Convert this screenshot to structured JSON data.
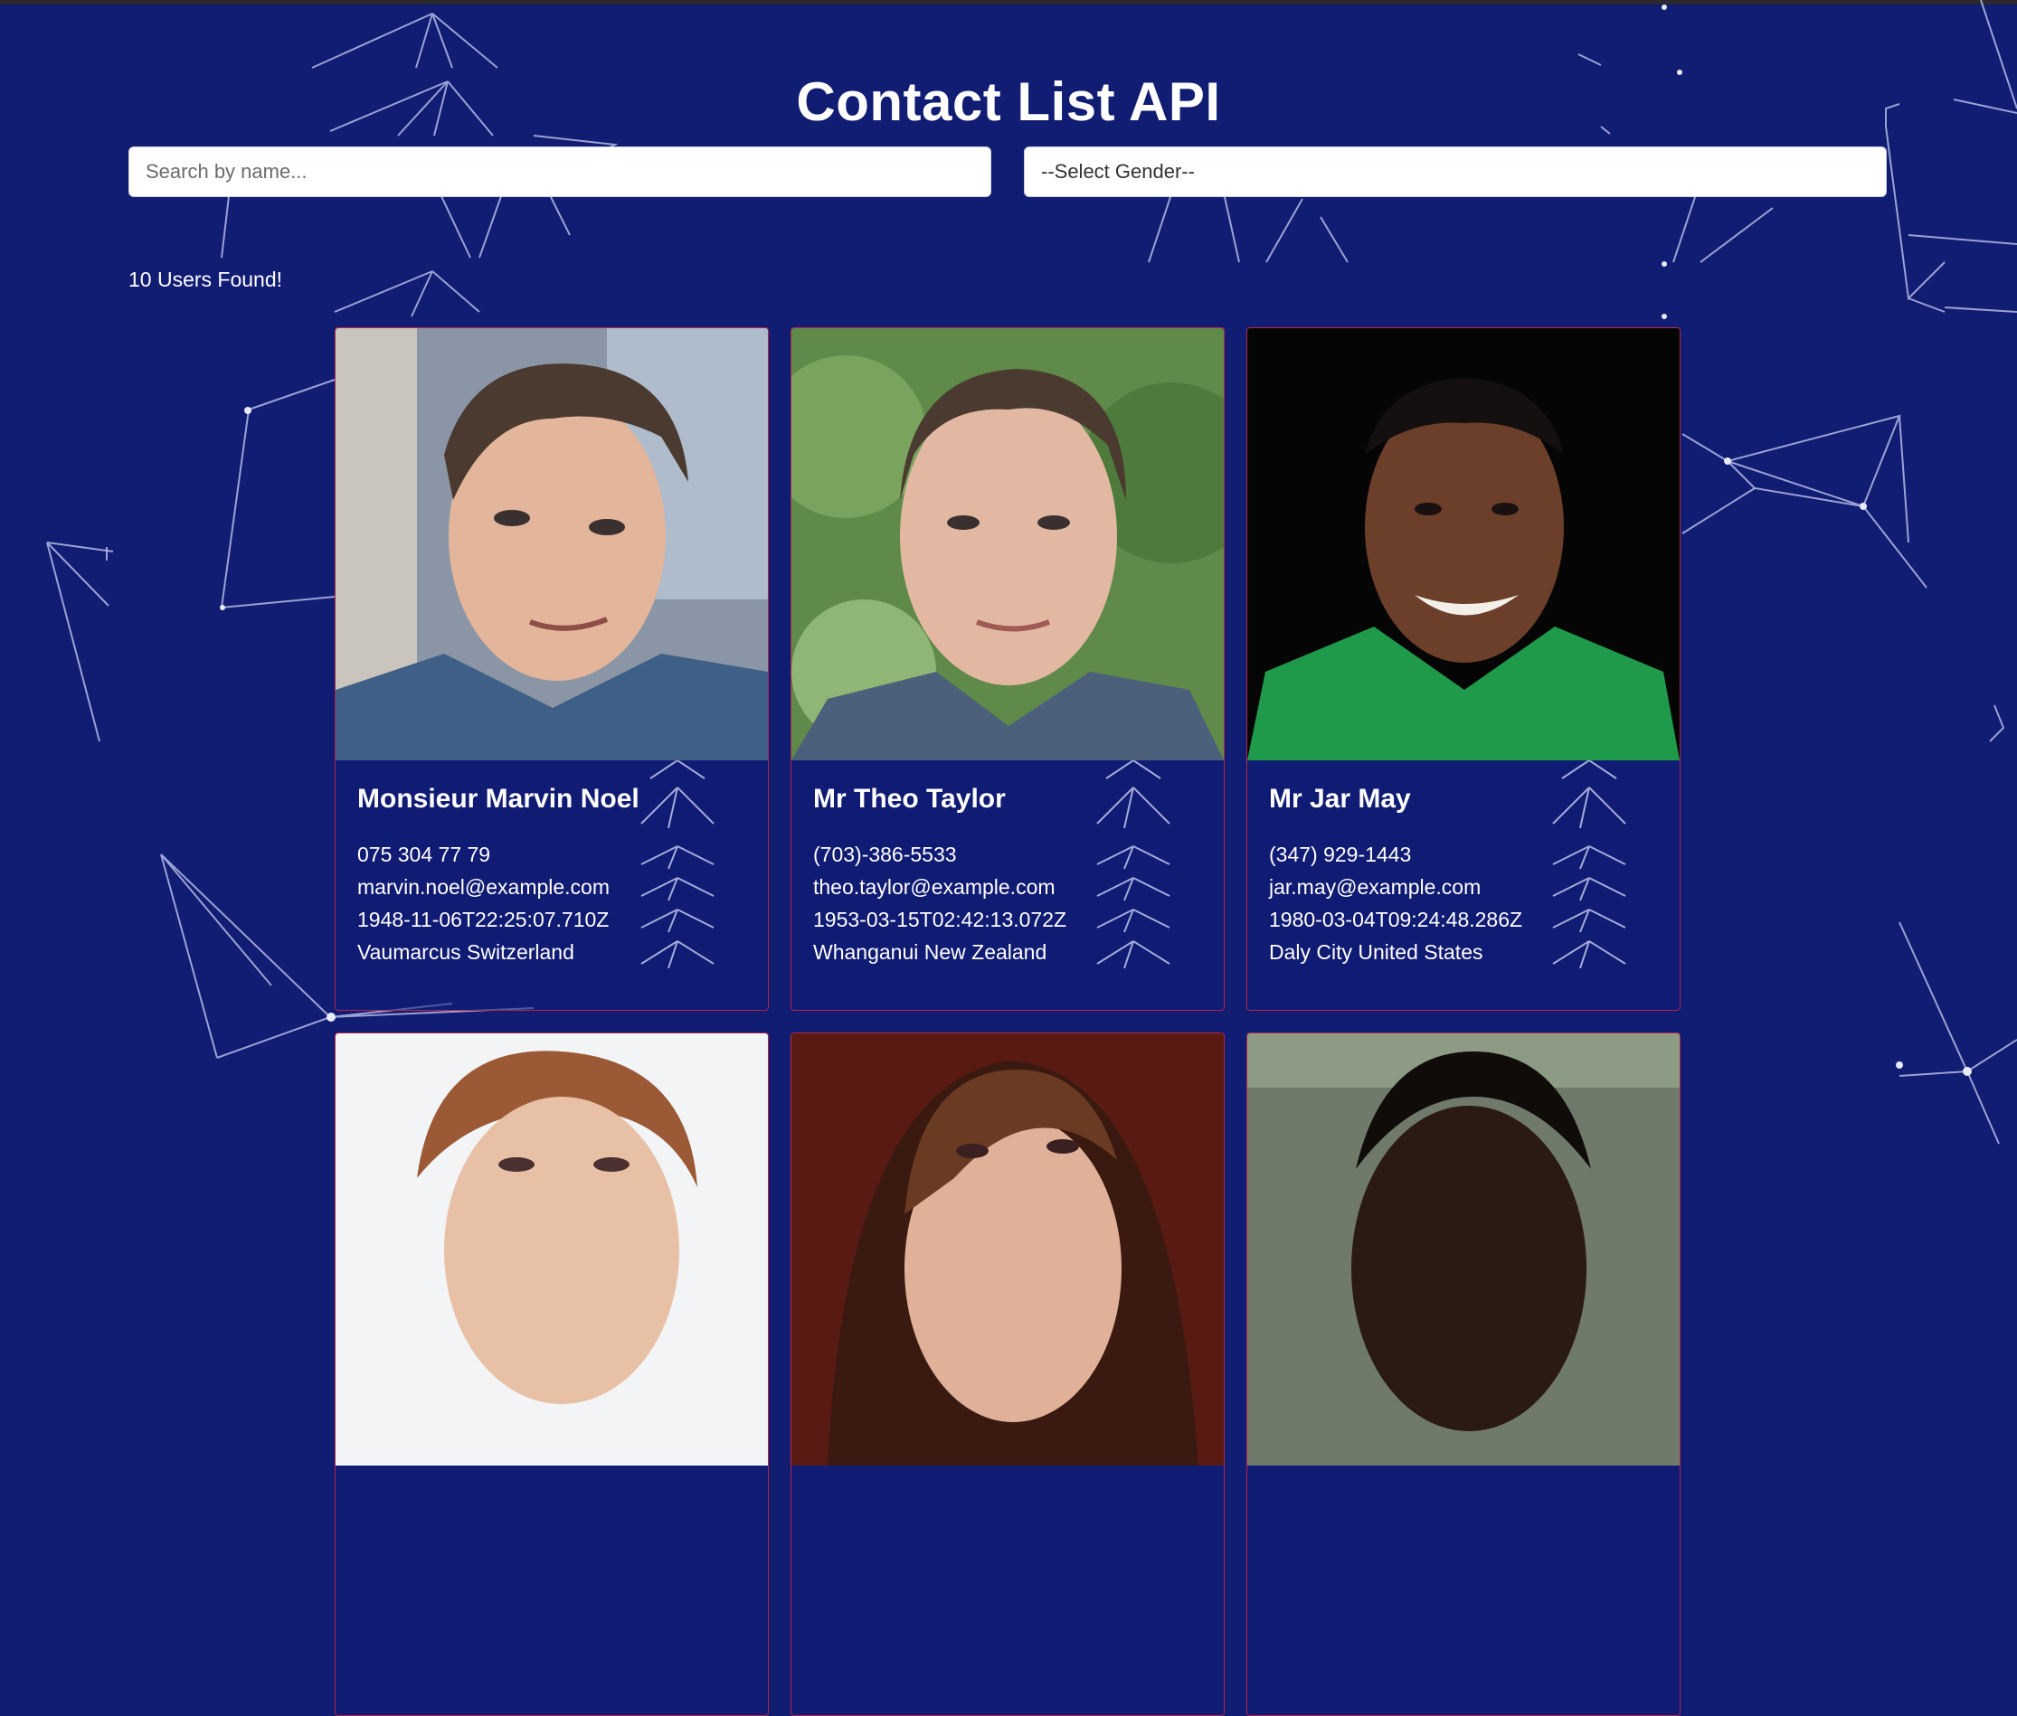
{
  "app": {
    "title": "Contact List API"
  },
  "filters": {
    "search_placeholder": "Search by name...",
    "gender_select_value": "--Select Gender--"
  },
  "results": {
    "count_text": "10 Users Found!"
  },
  "contacts": [
    {
      "name": "Monsieur Marvin Noel",
      "phone": "075 304 77 79",
      "email": "marvin.noel@example.com",
      "dob": "1948-11-06T22:25:07.710Z",
      "location": "Vaumarcus Switzerland"
    },
    {
      "name": "Mr Theo Taylor",
      "phone": "(703)-386-5533",
      "email": "theo.taylor@example.com",
      "dob": "1953-03-15T02:42:13.072Z",
      "location": "Whanganui New Zealand"
    },
    {
      "name": "Mr Jar May",
      "phone": "(347) 929-1443",
      "email": "jar.may@example.com",
      "dob": "1980-03-04T09:24:48.286Z",
      "location": "Daly City United States"
    }
  ],
  "colors": {
    "background": "#111c73",
    "card_border": "#b3264a",
    "text": "#ffffff"
  }
}
